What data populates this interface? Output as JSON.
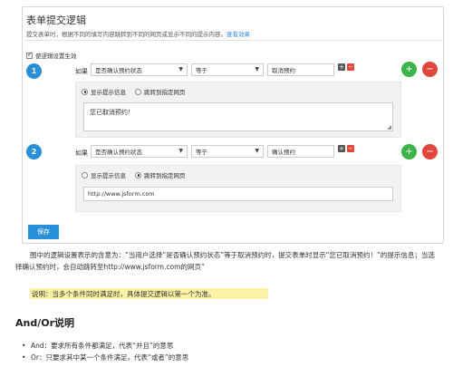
{
  "panel": {
    "title": "表单提交逻辑",
    "desc": "提交表单时，根据不同的填写内容跳转到不同的网页或显示不同的提示内容。",
    "desc_link": "查看效果",
    "enable_label": "使逻辑设置生效",
    "save_label": "保存"
  },
  "rules": [
    {
      "index": "1",
      "if_label": "如果",
      "field": "是否确认预约状态",
      "operator": "等于",
      "value": "取消预约",
      "option_show": "显示提示信息",
      "option_redirect": "跳转到指定网页",
      "selected": "show",
      "message": "您已取消预约！"
    },
    {
      "index": "2",
      "if_label": "如果",
      "field": "是否确认预约状态",
      "operator": "等于",
      "value": "确认预约",
      "option_show": "显示提示信息",
      "option_redirect": "跳转到指定网页",
      "selected": "redirect",
      "url": "http://www.jsform.com"
    }
  ],
  "content": {
    "paragraph": "图中的逻辑设置表示的含意为：“当用户选择“是否确认预约状态”等于取消预约时，提交表单时显示“您已取消预约！”的提示信息；当选择确认预约时，会自动跳转至http://www.jsform.com的网页”",
    "note": "说明：当多个条件同时满足时，具体提交逻辑以第一个为准。",
    "heading": "And/Or说明",
    "bullets": [
      "And：要求所有条件都满足，代表“并且”的意思",
      "Or：只要求其中某一个条件满足，代表“或者”的意思"
    ]
  },
  "colors": {
    "accent": "#2a8fd9",
    "green": "#3bb54a",
    "red": "#e0463c",
    "highlight": "#fbf3a6"
  },
  "icons": [
    "chevron-down-icon",
    "plus-icon",
    "minus-icon",
    "checkbox-icon",
    "radio-icon",
    "resize-handle-icon"
  ]
}
